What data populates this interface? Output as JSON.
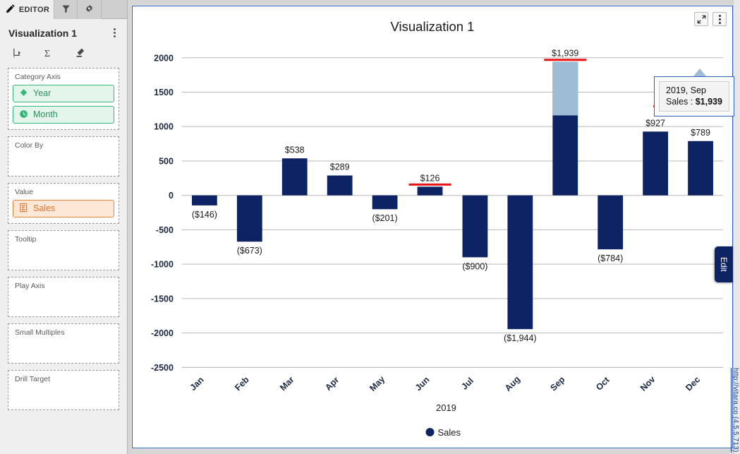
{
  "sidebar": {
    "tabs": [
      {
        "label": "EDITOR",
        "icon": "pencil-icon",
        "active": true
      },
      {
        "label": "",
        "icon": "filter-icon",
        "active": false
      },
      {
        "label": "",
        "icon": "gear-icon",
        "active": false
      }
    ],
    "viz_title": "Visualization 1",
    "toolbar_icons": [
      "drill-down-icon",
      "sigma-aggregate-icon",
      "eraser-clear-icon"
    ],
    "shelves": [
      {
        "label": "Category Axis",
        "pills": [
          {
            "text": "Year",
            "style": "green",
            "icon": "diamond-icon"
          },
          {
            "text": "Month",
            "style": "green",
            "icon": "clock-icon"
          }
        ]
      },
      {
        "label": "Color By",
        "pills": []
      },
      {
        "label": "Value",
        "pills": [
          {
            "text": "Sales",
            "style": "orange",
            "icon": "measure-icon"
          }
        ]
      },
      {
        "label": "Tooltip",
        "pills": []
      },
      {
        "label": "Play Axis",
        "pills": []
      },
      {
        "label": "Small Multiples",
        "pills": []
      },
      {
        "label": "Drill Target",
        "pills": []
      }
    ]
  },
  "panel": {
    "expand_icon": "expand-arrows-icon",
    "menu_icon": "kebab-menu-icon",
    "edit_tab_label": "Edit",
    "footer_url": "http://vitara.co (4.5.5.713)"
  },
  "tooltip": {
    "line1": "2019, Sep",
    "line2_label": "Sales : ",
    "line2_value": "$1,939"
  },
  "chart_data": {
    "type": "bar",
    "title": "Visualization 1",
    "xlabel": "2019",
    "ylabel": "",
    "categories": [
      "Jan",
      "Feb",
      "Mar",
      "Apr",
      "May",
      "Jun",
      "Jul",
      "Aug",
      "Sep",
      "Oct",
      "Nov",
      "Dec"
    ],
    "values": [
      -146,
      -673,
      538,
      289,
      -201,
      126,
      -900,
      -1944,
      1939,
      -784,
      927,
      789
    ],
    "data_labels": [
      "($146)",
      "($673)",
      "$538",
      "$289",
      "($201)",
      "$126",
      "($900)",
      "($1,944)",
      "$1,939",
      "($784)",
      "$927",
      "$789"
    ],
    "ylim": [
      -2500,
      2000
    ],
    "yticks": [
      2000,
      1500,
      1000,
      500,
      0,
      -500,
      -1000,
      -1500,
      -2000,
      -2500
    ],
    "ytick_labels": [
      "2000",
      "1500",
      "1000",
      "500",
      "0",
      "-500",
      "-1000",
      "-1500",
      "-2000",
      "-2500"
    ],
    "grid": true,
    "legend": [
      {
        "name": "Sales",
        "color": "#0d2364"
      }
    ],
    "legend_position": "bottom",
    "series_color": "#0d2364",
    "highlighted_category": "Sep",
    "annotated_categories": [
      "Jun",
      "Sep"
    ],
    "annotation_color": "#e81313"
  }
}
